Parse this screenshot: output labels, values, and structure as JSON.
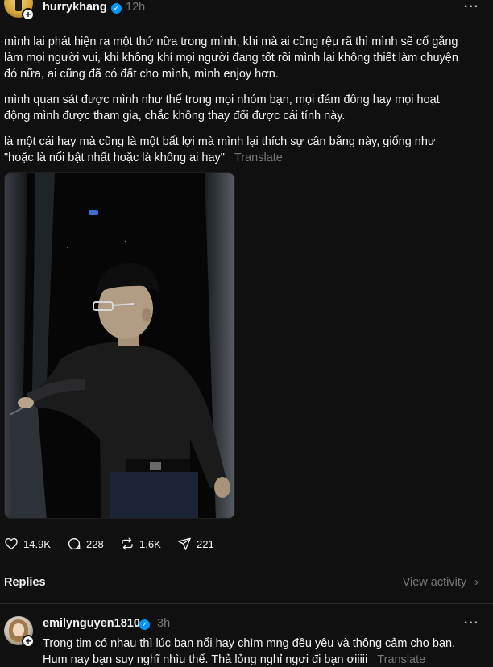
{
  "post": {
    "username": "hurrykhang",
    "time": "12h",
    "more_icon": "···",
    "plus_icon": "+",
    "verified_icon": "✓",
    "paragraph_1_line_1": "mình lại phát hiện ra một thứ nữa trong mình, khi mà ai cũng rệu rã thì mình sẽ cố gắng",
    "paragraph_1_line_2": "làm mọi người vui, khi không khí mọi người đang tốt rồi mình lại không thiết làm chuyện",
    "paragraph_1_line_3": "đó nữa, ai cũng đã có đất cho mình, mình enjoy hơn.",
    "paragraph_2_line_1": "mình quan sát được mình như thế trong mọi nhóm bạn, mọi đám đông hay mọi hoạt",
    "paragraph_2_line_2": "động mình được tham gia, chắc không thay đổi được cái tính này.",
    "paragraph_3_line_1": "là một cái hay mà cũng là một bất lợi mà mình lại thích sự cân bằng này, giống như",
    "paragraph_3_line_2": "\"hoặc là nổi bật nhất hoặc là không ai hay\"",
    "translate_label": "Translate",
    "stats": {
      "likes": "14.9K",
      "comments": "228",
      "reposts": "1.6K",
      "shares": "221"
    }
  },
  "replies_section": {
    "title": "Replies",
    "view_activity": "View activity",
    "chevron_icon": "›"
  },
  "reply": {
    "username": "emilynguyen1810",
    "time": "3h",
    "more_icon": "···",
    "plus_icon": "+",
    "verified_icon": "✓",
    "line_1": "Trong tim có nhau thì lúc bạn nổi hay chìm mng đều yêu và thông cảm cho bạn.",
    "line_2": "Hum nay bạn suy nghĩ nhìu thế. Thả lỏng nghỉ ngơi đi bạn ơiiiii",
    "translate_label": "Translate"
  },
  "colors": {
    "background": "#101010",
    "text": "#f3f5f7",
    "muted": "#777777",
    "verified": "#0095f6"
  }
}
